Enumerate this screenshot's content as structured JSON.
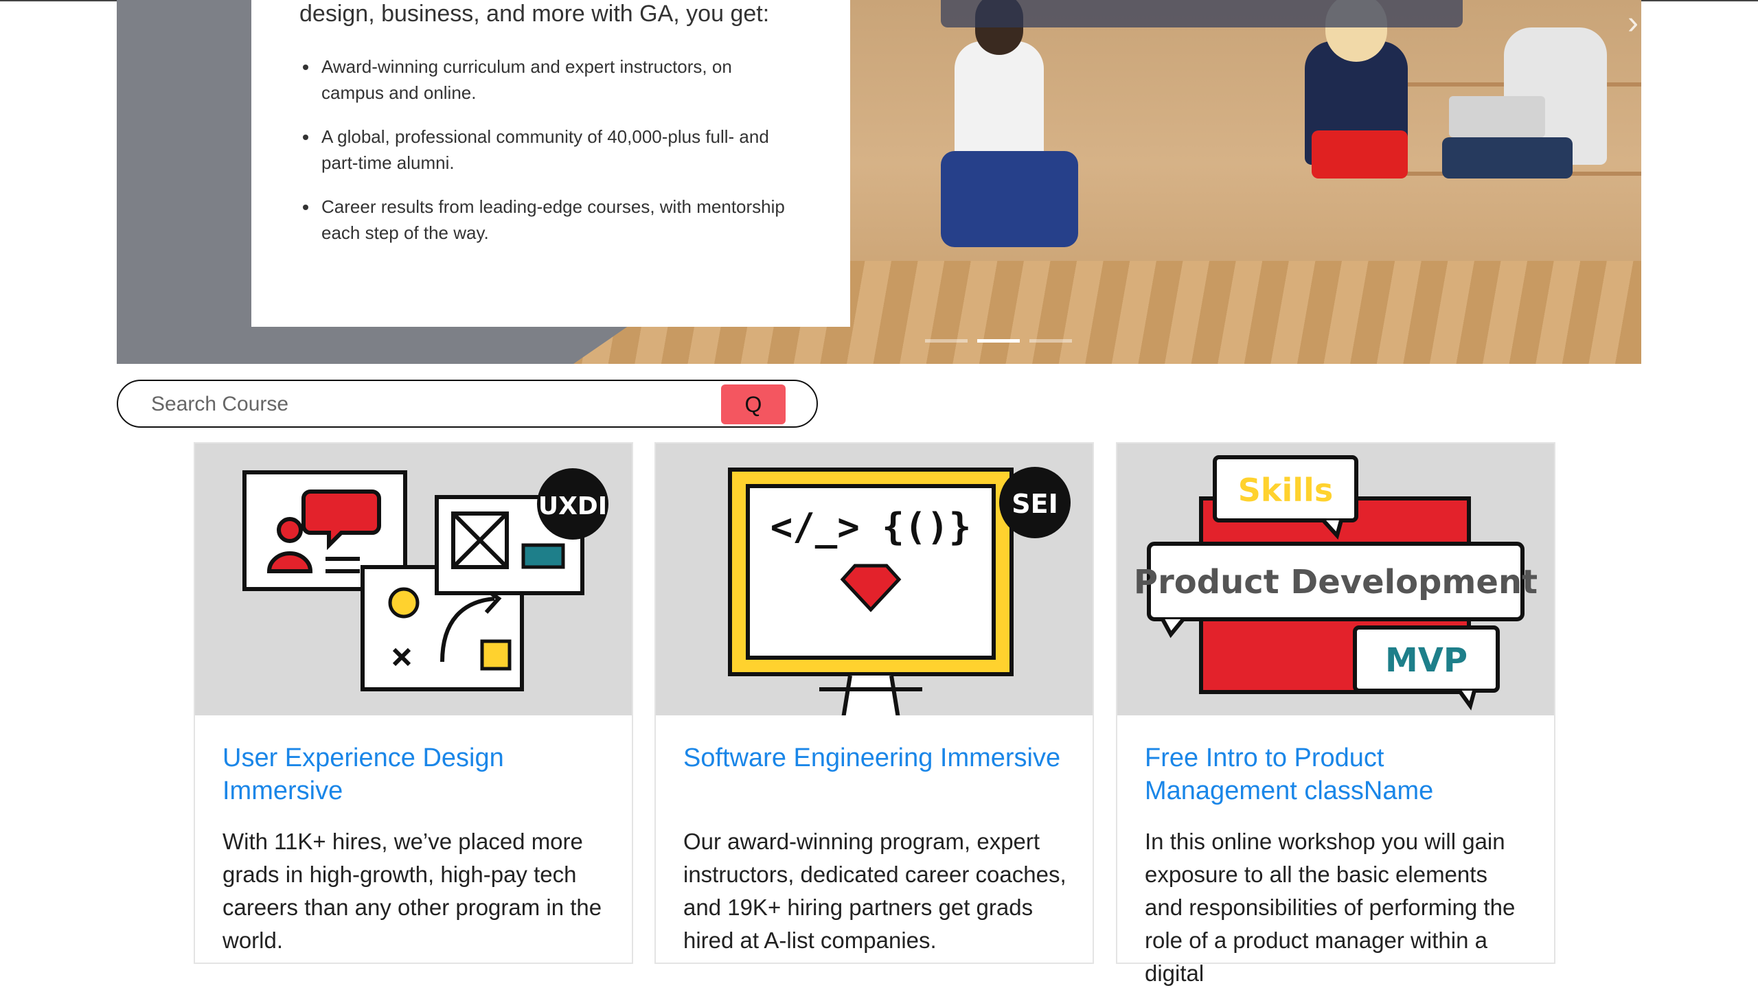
{
  "hero": {
    "lead": "design, business, and more with GA, you get:",
    "bullets": [
      "Award-winning curriculum and expert instructors, on campus and online.",
      "A global, professional community of 40,000-plus full- and part-time alumni.",
      "Career results from leading-edge courses, with mentorship each step of the way."
    ],
    "carousel": {
      "slides": 3,
      "active_index": 1,
      "next_icon": "chevron-right-icon"
    }
  },
  "search": {
    "placeholder": "Search Course",
    "button_label": "Q",
    "button_color": "#f45660"
  },
  "courses": [
    {
      "badge": "UXDI",
      "title": "User Experience Design Immersive",
      "description": "With 11K+ hires, we’ve placed more grads in high-growth, high-pay tech careers than any other program in the world."
    },
    {
      "badge": "SEI",
      "code_glyph": "</_> {()}",
      "title": "Software Engineering Immersive",
      "description": "Our award-winning program, expert instructors, dedicated career coaches, and 19K+ hiring partners get grads hired at A-list companies."
    },
    {
      "labels": [
        "Skills",
        "Product Development",
        "MVP"
      ],
      "title": "Free Intro to Product Management className",
      "description": "In this online workshop you will gain exposure to all the basic elements and responsibilities of performing the role of a product manager within a digital"
    }
  ],
  "colors": {
    "link": "#1a86e8",
    "accent_red": "#e3222b",
    "accent_yellow": "#ffd22e",
    "teal": "#1e7f8a"
  }
}
